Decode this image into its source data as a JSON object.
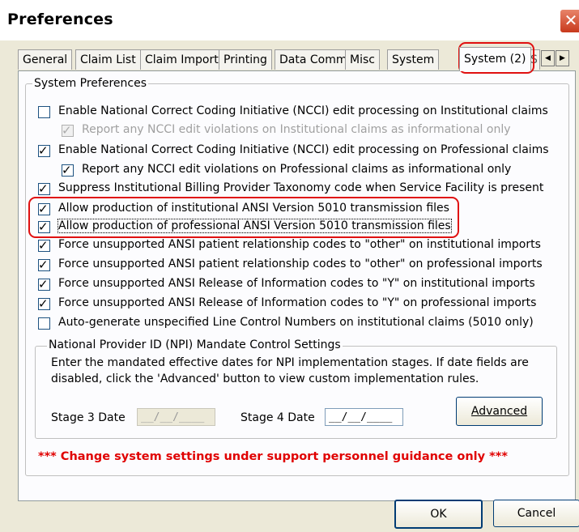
{
  "window": {
    "title": "Preferences",
    "close_glyph": "✕"
  },
  "tabs": [
    {
      "label": "General"
    },
    {
      "label": "Claim List"
    },
    {
      "label": "Claim Import"
    },
    {
      "label": "Printing"
    },
    {
      "label": "Data Comm"
    },
    {
      "label": "Misc"
    },
    {
      "label": "System"
    },
    {
      "label": "System (2)",
      "active": true
    },
    {
      "label": "S"
    }
  ],
  "tab_scroll": {
    "left": "◀",
    "right": "▶"
  },
  "system_preferences": {
    "legend": "System Preferences",
    "options": [
      {
        "label": "Enable National Correct Coding Initiative (NCCI) edit processing on Institutional claims",
        "checked": false,
        "enabled": true
      },
      {
        "label": "Report any NCCI edit violations on Institutional claims as informational only",
        "checked": true,
        "enabled": false
      },
      {
        "label": "Enable National Correct Coding Initiative (NCCI) edit processing on Professional claims",
        "checked": true,
        "enabled": true
      },
      {
        "label": "Report any NCCI edit violations on Professional claims as informational only",
        "checked": true,
        "enabled": true
      },
      {
        "label": "Suppress Institutional Billing Provider Taxonomy code when Service Facility is present",
        "checked": true,
        "enabled": true
      },
      {
        "label": "Allow production of institutional ANSI Version 5010 transmission files",
        "checked": true,
        "enabled": true
      },
      {
        "label": "Allow production of professional ANSI Version 5010 transmission files",
        "checked": true,
        "enabled": true
      },
      {
        "label": "Force unsupported ANSI patient relationship codes to \"other\" on institutional imports",
        "checked": true,
        "enabled": true
      },
      {
        "label": "Force unsupported ANSI patient relationship codes to \"other\" on professional imports",
        "checked": true,
        "enabled": true
      },
      {
        "label": "Force unsupported ANSI Release of Information codes to \"Y\" on institutional imports",
        "checked": true,
        "enabled": true
      },
      {
        "label": "Force unsupported ANSI Release of Information codes to \"Y\" on professional imports",
        "checked": true,
        "enabled": true
      },
      {
        "label": "Auto-generate unspecified Line Control Numbers on institutional claims (5010 only)",
        "checked": false,
        "enabled": true
      }
    ]
  },
  "npi": {
    "legend": "National Provider ID (NPI) Mandate Control Settings",
    "description_line1": "Enter the mandated effective dates for NPI implementation stages.  If date fields are",
    "description_line2": "disabled, click the 'Advanced' button to view custom implementation rules.",
    "stage3_label": "Stage 3 Date",
    "stage3_value": "__/__/____",
    "stage4_label": "Stage 4 Date",
    "stage4_value": "__/__/____",
    "advanced_button": "Advanced"
  },
  "warning_text": "*** Change system settings under support personnel guidance only ***",
  "footer": {
    "ok_button": "OK",
    "cancel_button": "Cancel"
  },
  "colors": {
    "highlight": "#e01010",
    "warning": "#e00000",
    "window_bg": "#ece9d8"
  }
}
